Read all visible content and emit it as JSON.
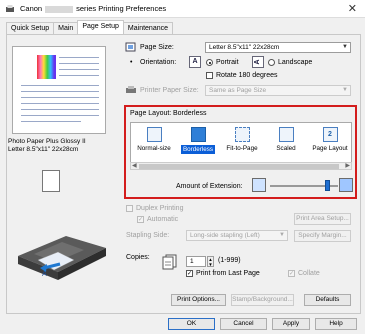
{
  "window": {
    "title_prefix": "Canon",
    "title_suffix": "series Printing Preferences",
    "close_glyph": "✕"
  },
  "tabs": [
    "Quick Setup",
    "Main",
    "Page Setup",
    "Maintenance"
  ],
  "preview": {
    "paper_line1": "Photo Paper Plus Glossy II",
    "paper_line2": "Letter 8.5\"x11\" 22x28cm"
  },
  "page_size": {
    "label": "Page Size:",
    "value": "Letter 8.5\"x11\" 22x28cm"
  },
  "orientation": {
    "label": "Orientation:",
    "portrait": "Portrait",
    "landscape": "Landscape",
    "rotate": "Rotate 180 degrees",
    "icon_letter": "A"
  },
  "printer_paper_size": {
    "label": "Printer Paper Size:",
    "value": "Same as Page Size"
  },
  "page_layout": {
    "label": "Page Layout:",
    "current": "Borderless",
    "items": [
      "Normal-size",
      "Borderless",
      "Fit-to-Page",
      "Scaled",
      "Page Layout"
    ],
    "page_layout_number": "2",
    "amount_label": "Amount of Extension:",
    "amount_level": 0.85
  },
  "duplex": {
    "label": "Duplex Printing",
    "automatic": "Automatic",
    "print_area_button": "Print Area Setup...",
    "stapling_label": "Stapling Side:",
    "stapling_value": "Long-side stapling (Left)",
    "specify_margin_button": "Specify Margin..."
  },
  "copies": {
    "label": "Copies:",
    "value": "1",
    "range": "(1-999)",
    "print_from_last": "Print from Last Page",
    "collate": "Collate"
  },
  "buttons": {
    "print_options": "Print Options...",
    "stamp_background": "Stamp/Background...",
    "defaults": "Defaults",
    "ok": "OK",
    "cancel": "Cancel",
    "apply": "Apply",
    "help": "Help"
  },
  "colors": {
    "highlight": "#d31c1c",
    "selection": "#0b5ed7"
  }
}
